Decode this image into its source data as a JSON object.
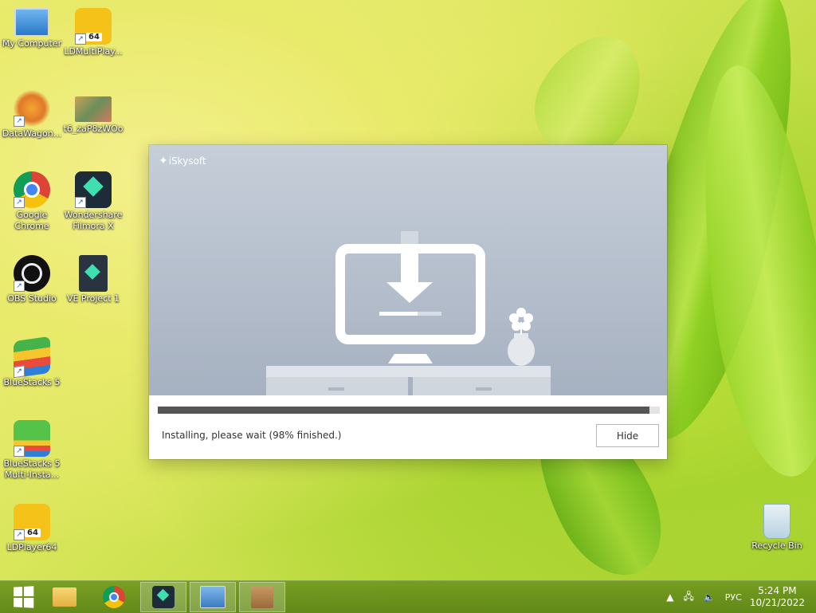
{
  "desktop": {
    "icons": [
      {
        "label": "My Computer",
        "icon": "computer-icon"
      },
      {
        "label": "LDMultiPlay...",
        "icon": "ldmultiplayer-icon",
        "badge": "64"
      },
      {
        "label": "DataWagon...",
        "icon": "datawagon-icon"
      },
      {
        "label": "t6_zaP8zWOo",
        "icon": "image-file-icon"
      },
      {
        "label": "Google Chrome",
        "icon": "chrome-icon"
      },
      {
        "label": "Wondershare Filmora X",
        "icon": "filmora-icon"
      },
      {
        "label": "OBS Studio",
        "icon": "obs-icon"
      },
      {
        "label": "VE Project 1",
        "icon": "filmora-project-icon"
      },
      {
        "label": "BlueStacks 5",
        "icon": "bluestacks-icon"
      },
      {
        "label": "BlueStacks 5 Multi-Insta...",
        "icon": "bluestacks-multi-icon"
      },
      {
        "label": "LDPlayer64",
        "icon": "ldplayer-icon",
        "badge": "64"
      },
      {
        "label": "Recycle Bin",
        "icon": "recycle-bin-icon"
      }
    ]
  },
  "installer": {
    "brand": "iSkysoft",
    "progress_percent": 98,
    "status": "Installing, please wait (98% finished.)",
    "hide_label": "Hide"
  },
  "taskbar": {
    "items": [
      {
        "icon": "windows-start-icon"
      },
      {
        "icon": "file-explorer-icon"
      },
      {
        "icon": "chrome-icon"
      },
      {
        "icon": "filmora-icon"
      },
      {
        "icon": "control-panel-icon"
      },
      {
        "icon": "installer-box-icon"
      }
    ],
    "tray": {
      "language": "РУС",
      "time": "5:24 PM",
      "date": "10/21/2022"
    }
  }
}
